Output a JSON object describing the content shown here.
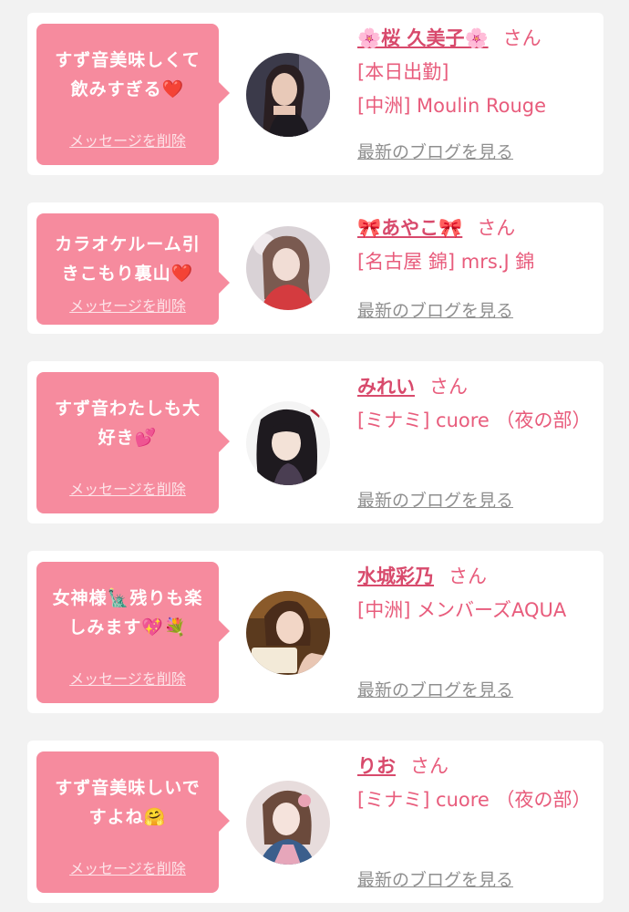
{
  "delete_label": "メッセージを削除",
  "blog_label": "最新のブログを見る",
  "honorific": "さん",
  "colors": {
    "bubble": "#f68b9e",
    "name": "#d84a6c",
    "text": "#e85c7c",
    "blog_link": "#8f8f8f",
    "background": "#f2f2f2"
  },
  "cards": [
    {
      "message_line1": "すず音美味しくて",
      "message_line2": "飲みすぎる",
      "message_emoji": "❤️",
      "name": "🌸桜 久美子🌸",
      "status": "[本日出勤]",
      "shop": "[中洲] Moulin Rouge",
      "avatar_icon": "woman-photo-icon"
    },
    {
      "message_line1": "カラオケルーム引",
      "message_line2": "きこもり裏山",
      "message_emoji": "❤️",
      "name": "🎀あやこ🎀",
      "status": "",
      "shop": "[名古屋 錦] mrs.J 錦",
      "avatar_icon": "woman-photo-icon"
    },
    {
      "message_line1": "すず音わたしも大",
      "message_line2": "好き",
      "message_emoji": "💕",
      "name": "みれい",
      "status": "",
      "shop": "[ミナミ] cuore （夜の部）",
      "avatar_icon": "anime-character-icon"
    },
    {
      "message_line1": "女神様🗽残りも楽",
      "message_line2": "しみます",
      "message_emoji": "💖💐",
      "name": "水城彩乃",
      "status": "",
      "shop": "[中洲] メンバーズAQUA",
      "avatar_icon": "woman-photo-icon"
    },
    {
      "message_line1": "すず音美味しいで",
      "message_line2": "すよね",
      "message_emoji": "🤗",
      "name": "りお",
      "status": "",
      "shop": "[ミナミ] cuore （夜の部）",
      "avatar_icon": "woman-photo-icon"
    }
  ]
}
